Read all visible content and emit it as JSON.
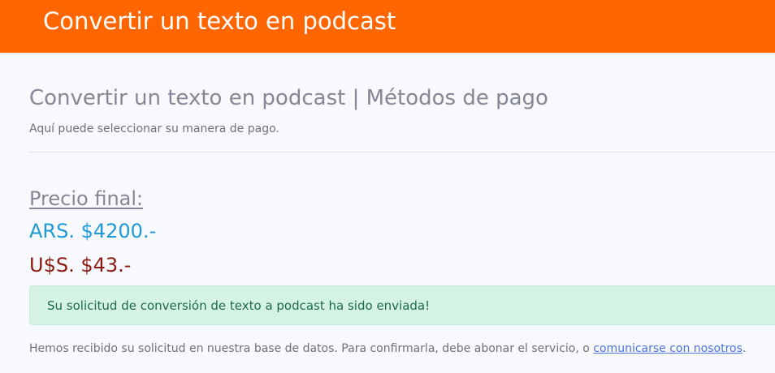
{
  "header": {
    "title": "Convertir un texto en podcast",
    "bg_color": "#ff6600"
  },
  "page": {
    "heading": "Convertir un texto en podcast | Métodos de pago",
    "subheading": "Aquí puede seleccionar su manera de pago."
  },
  "pricing": {
    "label": "Precio final:",
    "ars": "ARS. $4200.-",
    "usd": "U$S. $43.-",
    "ars_color": "#1e9ad6",
    "usd_color": "#8b1a10"
  },
  "alert": {
    "message": "Su solicitud de conversión de texto a podcast ha sido enviada!"
  },
  "info": {
    "text_before": "Hemos recibido su solicitud en nuestra base de datos. Para confirmarla, debe abonar el servicio, o ",
    "link_text": "comunicarse con nosotros",
    "text_after": "."
  }
}
